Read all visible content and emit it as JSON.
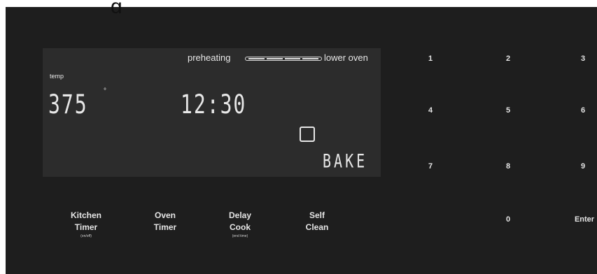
{
  "header_fragment": "g",
  "display": {
    "preheating_label": "preheating",
    "lower_oven_label": "lower oven",
    "temp_label": "temp",
    "temp_value": "375",
    "degree_symbol": "°",
    "clock": "12:30",
    "mode": "BAKE"
  },
  "keypad": {
    "digits": [
      "1",
      "2",
      "3",
      "4",
      "5",
      "6",
      "7",
      "8",
      "9",
      "0"
    ],
    "enter_label": "Enter"
  },
  "function_keys": [
    {
      "line1": "Kitchen",
      "line2": "Timer",
      "sub": "(on/off)"
    },
    {
      "line1": "Oven",
      "line2": "Timer",
      "sub": ""
    },
    {
      "line1": "Delay",
      "line2": "Cook",
      "sub": "(end time)"
    },
    {
      "line1": "Self",
      "line2": "Clean",
      "sub": ""
    }
  ],
  "colors": {
    "panel": "#1e1e1e",
    "display_bg": "#2c2c2c",
    "text": "#e7e7e7"
  }
}
